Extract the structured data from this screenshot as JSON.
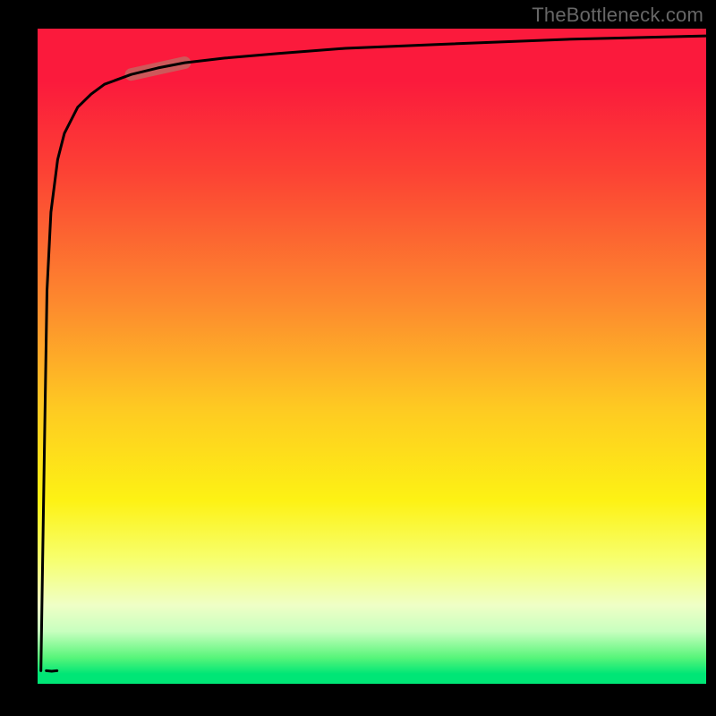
{
  "watermark": {
    "text": "TheBottleneck.com"
  },
  "chart_data": {
    "type": "line",
    "title": "",
    "xlabel": "",
    "ylabel": "",
    "xlim": [
      0,
      100
    ],
    "ylim": [
      0,
      100
    ],
    "grid": false,
    "legend": false,
    "series": [
      {
        "name": "curve",
        "x": [
          0.5,
          1,
          1.4,
          2,
          3,
          4,
          6,
          8,
          10,
          14,
          18,
          22,
          28,
          36,
          46,
          60,
          80,
          100
        ],
        "values": [
          2,
          35,
          60,
          72,
          80,
          84,
          88,
          90,
          91.5,
          93,
          94,
          94.8,
          95.5,
          96.2,
          97,
          97.6,
          98.4,
          98.9
        ]
      }
    ],
    "highlight_segment": {
      "x_start": 14,
      "x_end": 22
    },
    "background_gradient": {
      "direction": "vertical",
      "stops": [
        {
          "pos": 0.0,
          "color": "#fb1a3c"
        },
        {
          "pos": 0.42,
          "color": "#fd8a2e"
        },
        {
          "pos": 0.72,
          "color": "#fdf214"
        },
        {
          "pos": 0.92,
          "color": "#c8ffbf"
        },
        {
          "pos": 1.0,
          "color": "#00e676"
        }
      ]
    }
  }
}
